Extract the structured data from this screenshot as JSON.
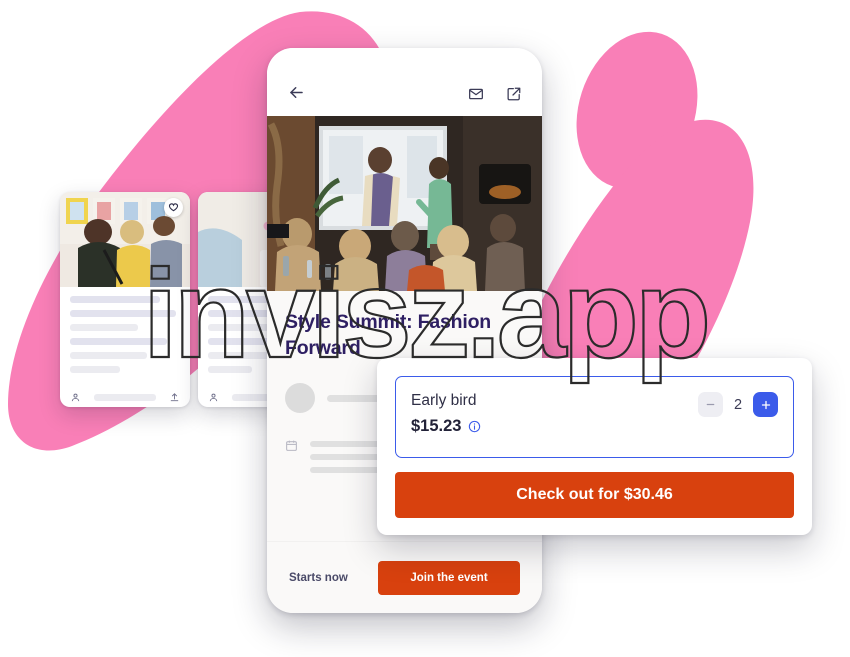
{
  "watermark": {
    "text": "invisz.app"
  },
  "phone": {
    "topbar": {
      "back_icon": "arrow-left-icon",
      "mail_icon": "envelope-icon",
      "share_icon": "external-link-icon"
    },
    "hero_alt": "event-photo-fashion-talk",
    "event_title": "Style Summit: Fashion Forward",
    "bottom_bar": {
      "status_text": "Starts now",
      "join_label": "Join the event"
    }
  },
  "checkout": {
    "ticket": {
      "name": "Early bird",
      "price": "$15.23",
      "info_icon": "info-circle-icon",
      "quantity": "2",
      "minus_label": "−",
      "plus_label": "+"
    },
    "checkout_label": "Check out for $30.46"
  },
  "cards": [
    {
      "heart_icon": "heart-icon",
      "person_icon": "person-icon",
      "share_icon": "upload-icon",
      "photo_alt": "gallery-visitors-photo"
    },
    {
      "person_icon": "person-icon",
      "photo_alt": "flowers-workshop-photo"
    }
  ],
  "colors": {
    "pink_blob": "#f97fb7",
    "orange_cta": "#d8410e",
    "blue_accent": "#3b5bea",
    "title_navy": "#2e1f63",
    "skeleton_gray": "#e4e4ec"
  }
}
